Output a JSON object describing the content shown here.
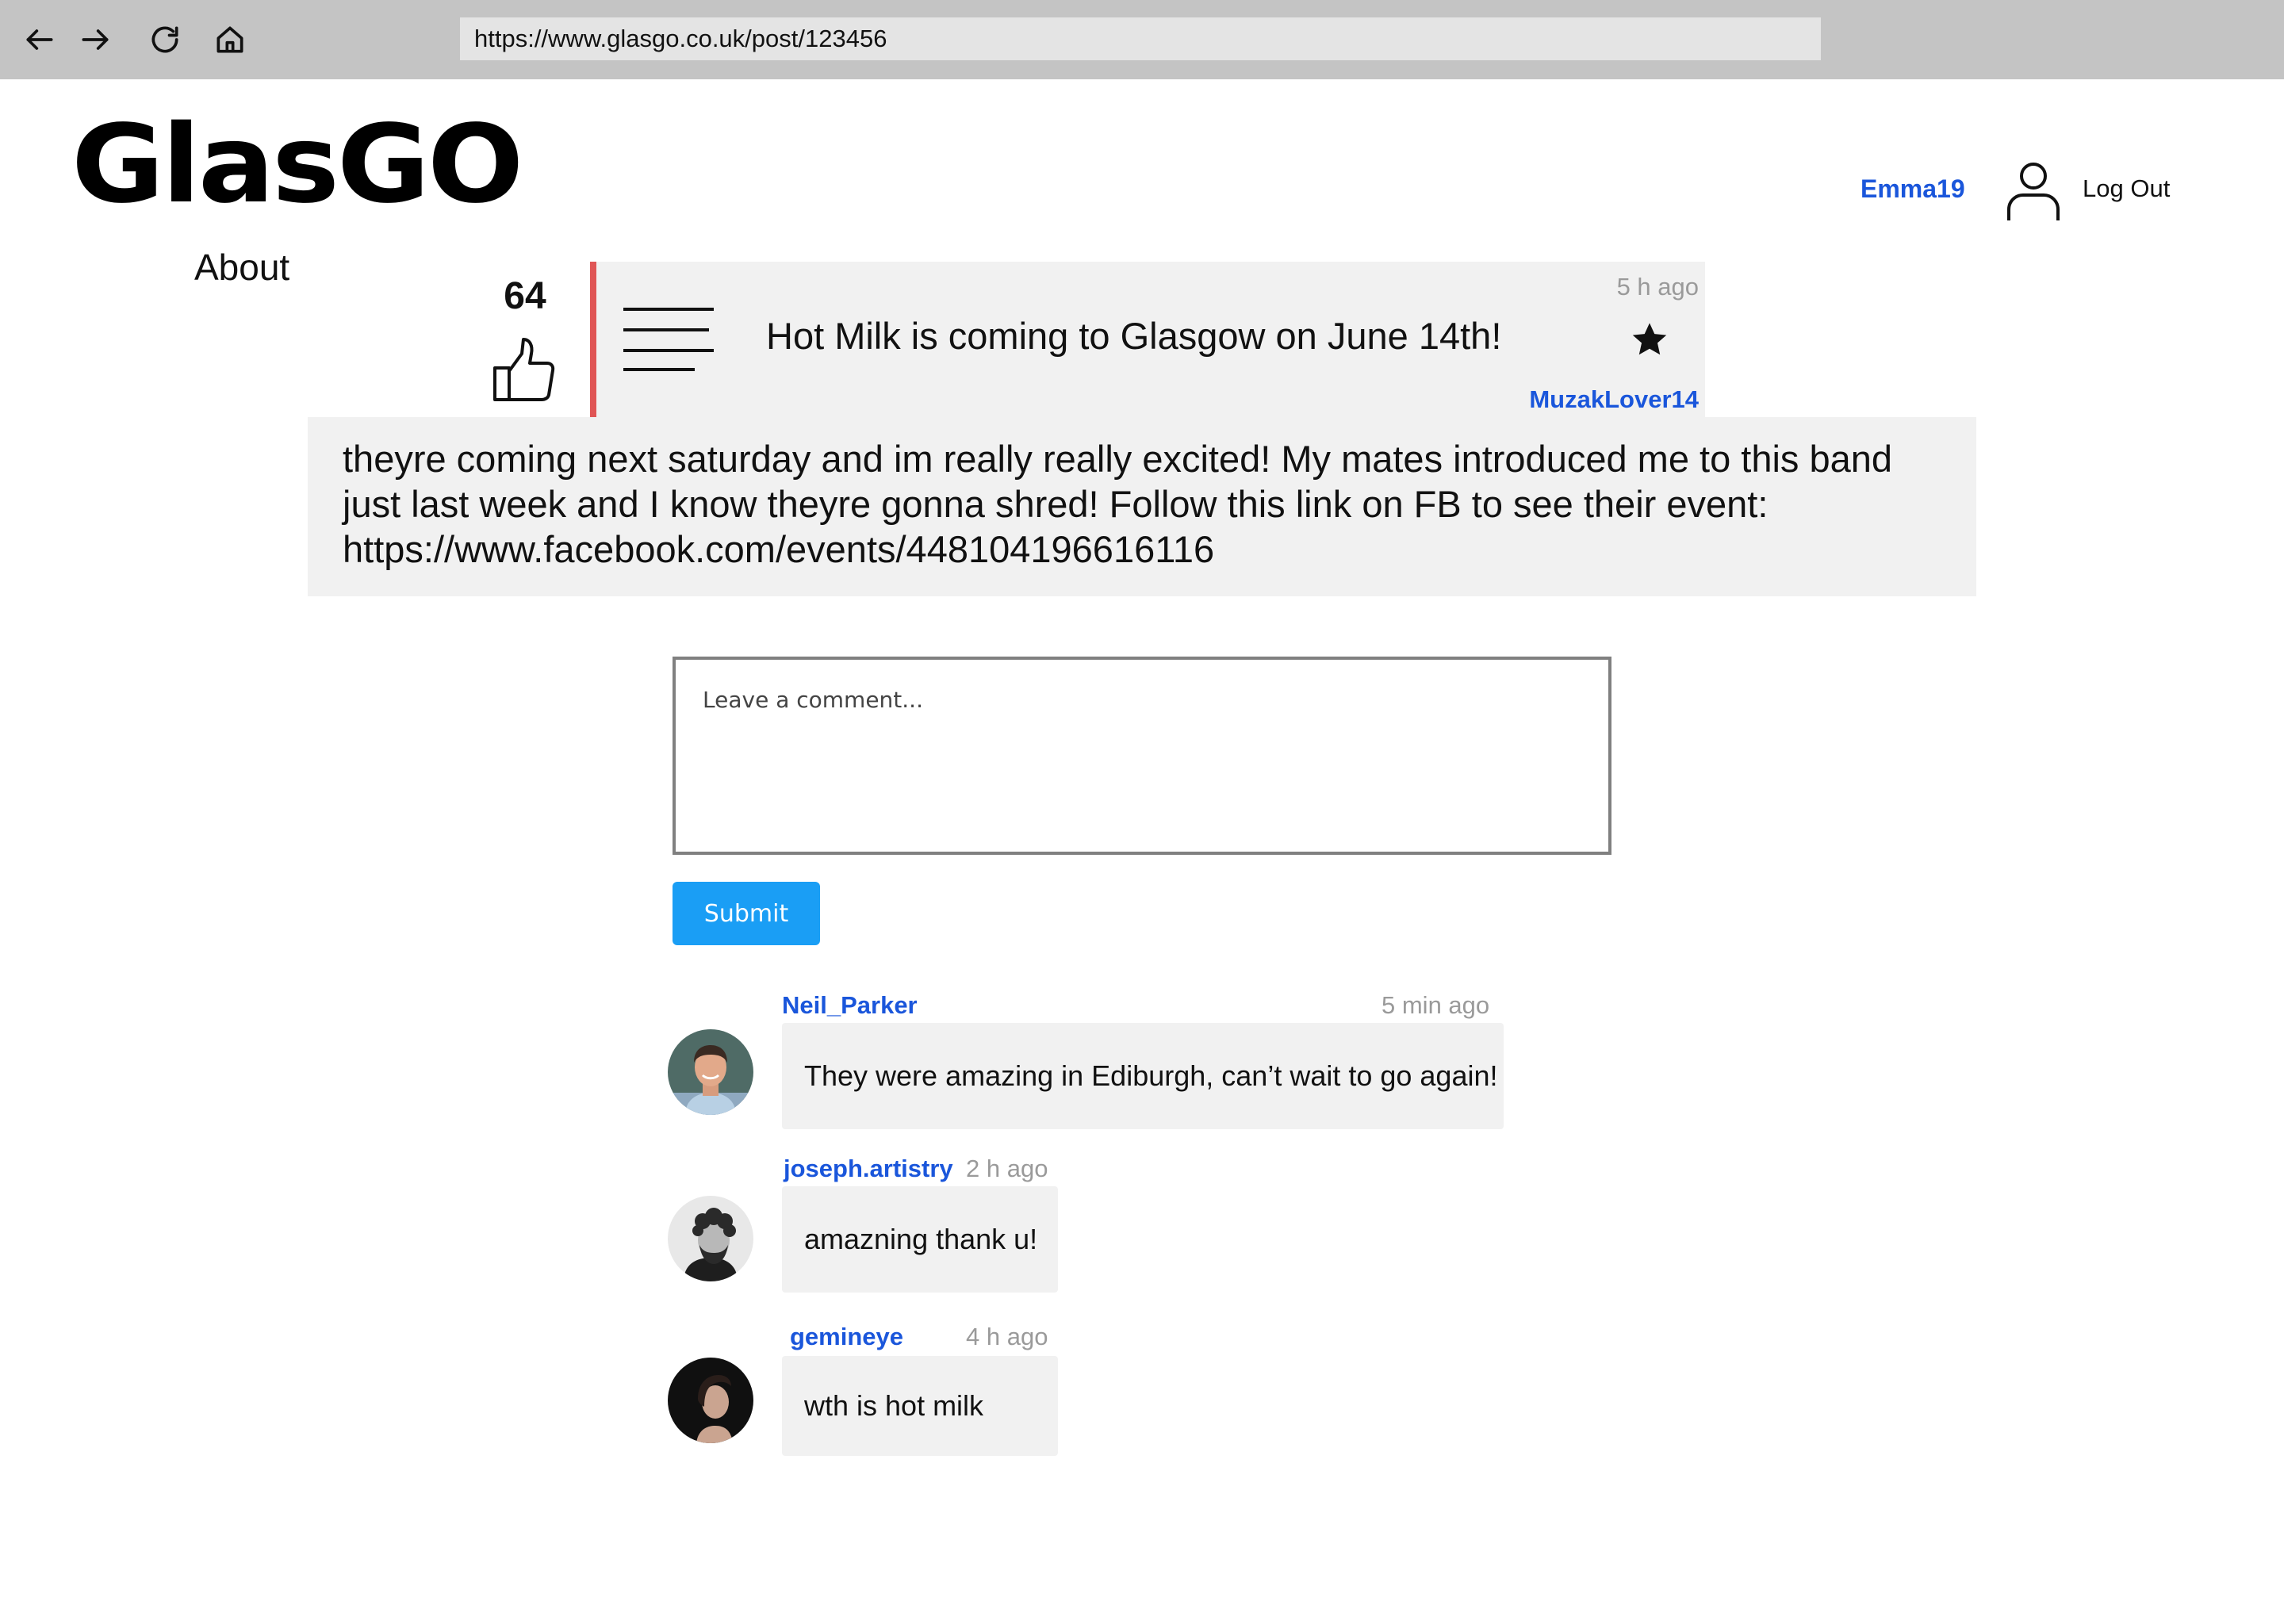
{
  "browser": {
    "url": "https://www.glasgo.co.uk/post/123456",
    "icons": [
      "back-arrow-icon",
      "forward-arrow-icon",
      "reload-icon",
      "home-icon"
    ]
  },
  "site": {
    "logo": "GlasGO",
    "about_label": "About",
    "username": "Emma19",
    "logout_label": "Log Out",
    "accent_color": "#1a56db",
    "post_accent_color": "#e05555"
  },
  "post": {
    "votes": "64",
    "title": "Hot Milk is coming to Glasgow on June 14th!",
    "time": "5 h ago",
    "author": "MuzakLover14",
    "body_lines": [
      "theyre coming next saturday and im really really excited! My mates introduced me to this band",
      "just last week and I know theyre gonna shred! Follow this link on FB to see their event:",
      "https://www.facebook.com/events/448104196616116"
    ],
    "favorited": true
  },
  "comment_form": {
    "placeholder": "Leave a comment...",
    "submit_label": "Submit",
    "submit_color": "#1a9ef5"
  },
  "comments": [
    {
      "author": "Neil_Parker",
      "time": "5 min ago",
      "text": "They were amazing in Ediburgh, can’t wait to go again!"
    },
    {
      "author": "joseph.artistry",
      "time": "2 h ago",
      "text": "amazning thank u!"
    },
    {
      "author": "gemineye",
      "time": "4 h ago",
      "text": "wth is hot milk"
    }
  ]
}
